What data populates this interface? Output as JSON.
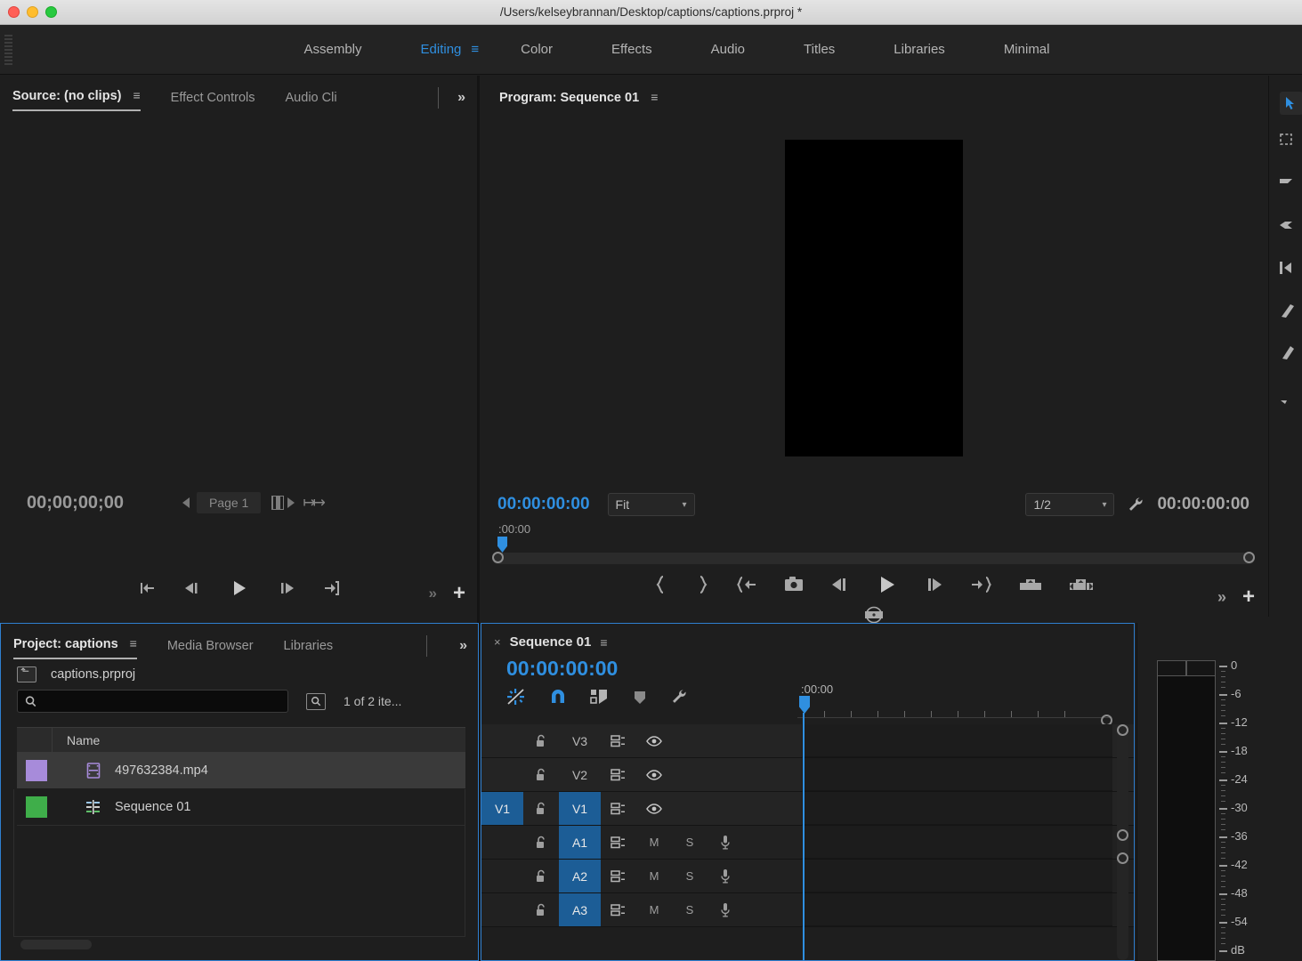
{
  "window": {
    "title": "/Users/kelseybrannan/Desktop/captions/captions.prproj *",
    "traffic_lights": [
      "close-button",
      "minimize-button",
      "zoom-button"
    ]
  },
  "workspace": {
    "items": [
      {
        "label": "Assembly",
        "active": false
      },
      {
        "label": "Editing",
        "active": true
      },
      {
        "label": "Color",
        "active": false
      },
      {
        "label": "Effects",
        "active": false
      },
      {
        "label": "Audio",
        "active": false
      },
      {
        "label": "Titles",
        "active": false
      },
      {
        "label": "Libraries",
        "active": false
      },
      {
        "label": "Minimal",
        "active": false
      }
    ],
    "menu_glyph": "≡",
    "accent_color": "#2f8fe0"
  },
  "source_monitor": {
    "tabs": [
      {
        "label": "Source: (no clips)",
        "active": true
      },
      {
        "label": "Effect Controls",
        "active": false
      },
      {
        "label": "Audio Cli",
        "active": false
      }
    ],
    "overflow_glyph": "»",
    "menu_glyph": "≡",
    "timecode": "00;00;00;00",
    "page_label": "Page 1",
    "transport_buttons": [
      "mark-in-out-icon",
      "step-back-icon",
      "play-icon",
      "step-forward-icon",
      "mark-out-icon"
    ],
    "overflow_button": "»",
    "add_button": "+"
  },
  "program_monitor": {
    "title": "Program: Sequence 01",
    "menu_glyph": "≡",
    "playhead_timecode": "00:00:00:00",
    "zoom_level": "Fit",
    "resolution": "1/2",
    "duration_timecode": "00:00:00:00",
    "ruler_label": ":00:00",
    "settings_icon": "wrench-icon",
    "transport_buttons": [
      "mark-in-icon",
      "mark-out-icon",
      "go-to-in-icon",
      "export-frame-icon",
      "step-back-icon",
      "play-icon",
      "step-forward-icon",
      "go-to-out-icon",
      "lift-icon",
      "extract-icon"
    ],
    "second_row_button": "safe-margins-icon",
    "overflow_button": "»",
    "add_button": "+"
  },
  "project_panel": {
    "tabs": [
      {
        "label": "Project: captions",
        "active": true
      },
      {
        "label": "Media Browser",
        "active": false
      },
      {
        "label": "Libraries",
        "active": false
      }
    ],
    "overflow_glyph": "»",
    "menu_glyph": "≡",
    "breadcrumb": "captions.prproj",
    "search_placeholder": "",
    "search_value": "",
    "item_count": "1 of 2 ite...",
    "columns": [
      "Name"
    ],
    "rows": [
      {
        "name": "497632384.mp4",
        "swatch": "#a78bda",
        "icon": "video-clip-icon",
        "selected": true
      },
      {
        "name": "Sequence 01",
        "swatch": "#3fae4a",
        "icon": "sequence-icon",
        "selected": false
      }
    ]
  },
  "timeline_panel": {
    "close_glyph": "×",
    "title": "Sequence 01",
    "menu_glyph": "≡",
    "timecode": "00:00:00:00",
    "tools": [
      {
        "name": "linked-selection-icon",
        "active": true
      },
      {
        "name": "snap-magnet-icon",
        "active": true
      },
      {
        "name": "add-marker-flag-icon",
        "active": false
      },
      {
        "name": "marker-icon",
        "active": false
      },
      {
        "name": "timeline-settings-wrench-icon",
        "active": false
      }
    ],
    "ruler_label": ":00:00",
    "tracks": [
      {
        "name": "V3",
        "type": "video",
        "targeted": false,
        "source_patch": "",
        "locked": false,
        "sync": true,
        "eye": true
      },
      {
        "name": "V2",
        "type": "video",
        "targeted": false,
        "source_patch": "",
        "locked": false,
        "sync": true,
        "eye": true
      },
      {
        "name": "V1",
        "type": "video",
        "targeted": true,
        "source_patch": "V1",
        "locked": false,
        "sync": true,
        "eye": true
      },
      {
        "name": "A1",
        "type": "audio",
        "targeted": true,
        "source_patch": "",
        "locked": false,
        "sync": true,
        "mute": "M",
        "solo": "S",
        "mic": true
      },
      {
        "name": "A2",
        "type": "audio",
        "targeted": true,
        "source_patch": "",
        "locked": false,
        "sync": true,
        "mute": "M",
        "solo": "S",
        "mic": true
      },
      {
        "name": "A3",
        "type": "audio",
        "targeted": true,
        "source_patch": "",
        "locked": false,
        "sync": true,
        "mute": "M",
        "solo": "S",
        "mic": true
      }
    ]
  },
  "audio_meter": {
    "scale_labels": [
      "0",
      "-6",
      "-12",
      "-18",
      "-24",
      "-30",
      "-36",
      "-42",
      "-48",
      "-54",
      "dB"
    ],
    "channels": 2
  },
  "tool_strip": {
    "tools": [
      "selection-tool-icon",
      "track-select-forward-tool-icon",
      "ripple-edit-tool-icon",
      "rolling-edit-tool-icon",
      "rate-stretch-tool-icon",
      "razor-tool-icon",
      "slip-tool-icon",
      "pen-tool-icon"
    ],
    "active_tool": "selection-tool-icon"
  },
  "colors": {
    "accent_blue": "#2f8fe0",
    "panel_bg": "#1e1e1e",
    "track_target_blue": "#1c5d96",
    "titlebar_bg": "#dcdcdc"
  }
}
